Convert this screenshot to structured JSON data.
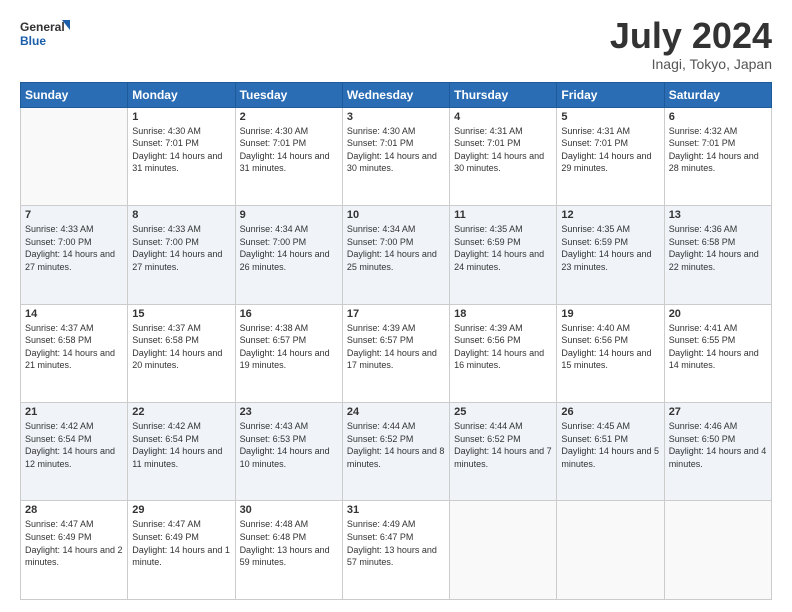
{
  "logo": {
    "line1": "General",
    "line2": "Blue"
  },
  "title": "July 2024",
  "subtitle": "Inagi, Tokyo, Japan",
  "headers": [
    "Sunday",
    "Monday",
    "Tuesday",
    "Wednesday",
    "Thursday",
    "Friday",
    "Saturday"
  ],
  "weeks": [
    [
      {
        "day": "",
        "sunrise": "",
        "sunset": "",
        "daylight": ""
      },
      {
        "day": "1",
        "sunrise": "Sunrise: 4:30 AM",
        "sunset": "Sunset: 7:01 PM",
        "daylight": "Daylight: 14 hours and 31 minutes."
      },
      {
        "day": "2",
        "sunrise": "Sunrise: 4:30 AM",
        "sunset": "Sunset: 7:01 PM",
        "daylight": "Daylight: 14 hours and 31 minutes."
      },
      {
        "day": "3",
        "sunrise": "Sunrise: 4:30 AM",
        "sunset": "Sunset: 7:01 PM",
        "daylight": "Daylight: 14 hours and 30 minutes."
      },
      {
        "day": "4",
        "sunrise": "Sunrise: 4:31 AM",
        "sunset": "Sunset: 7:01 PM",
        "daylight": "Daylight: 14 hours and 30 minutes."
      },
      {
        "day": "5",
        "sunrise": "Sunrise: 4:31 AM",
        "sunset": "Sunset: 7:01 PM",
        "daylight": "Daylight: 14 hours and 29 minutes."
      },
      {
        "day": "6",
        "sunrise": "Sunrise: 4:32 AM",
        "sunset": "Sunset: 7:01 PM",
        "daylight": "Daylight: 14 hours and 28 minutes."
      }
    ],
    [
      {
        "day": "7",
        "sunrise": "Sunrise: 4:33 AM",
        "sunset": "Sunset: 7:00 PM",
        "daylight": "Daylight: 14 hours and 27 minutes."
      },
      {
        "day": "8",
        "sunrise": "Sunrise: 4:33 AM",
        "sunset": "Sunset: 7:00 PM",
        "daylight": "Daylight: 14 hours and 27 minutes."
      },
      {
        "day": "9",
        "sunrise": "Sunrise: 4:34 AM",
        "sunset": "Sunset: 7:00 PM",
        "daylight": "Daylight: 14 hours and 26 minutes."
      },
      {
        "day": "10",
        "sunrise": "Sunrise: 4:34 AM",
        "sunset": "Sunset: 7:00 PM",
        "daylight": "Daylight: 14 hours and 25 minutes."
      },
      {
        "day": "11",
        "sunrise": "Sunrise: 4:35 AM",
        "sunset": "Sunset: 6:59 PM",
        "daylight": "Daylight: 14 hours and 24 minutes."
      },
      {
        "day": "12",
        "sunrise": "Sunrise: 4:35 AM",
        "sunset": "Sunset: 6:59 PM",
        "daylight": "Daylight: 14 hours and 23 minutes."
      },
      {
        "day": "13",
        "sunrise": "Sunrise: 4:36 AM",
        "sunset": "Sunset: 6:58 PM",
        "daylight": "Daylight: 14 hours and 22 minutes."
      }
    ],
    [
      {
        "day": "14",
        "sunrise": "Sunrise: 4:37 AM",
        "sunset": "Sunset: 6:58 PM",
        "daylight": "Daylight: 14 hours and 21 minutes."
      },
      {
        "day": "15",
        "sunrise": "Sunrise: 4:37 AM",
        "sunset": "Sunset: 6:58 PM",
        "daylight": "Daylight: 14 hours and 20 minutes."
      },
      {
        "day": "16",
        "sunrise": "Sunrise: 4:38 AM",
        "sunset": "Sunset: 6:57 PM",
        "daylight": "Daylight: 14 hours and 19 minutes."
      },
      {
        "day": "17",
        "sunrise": "Sunrise: 4:39 AM",
        "sunset": "Sunset: 6:57 PM",
        "daylight": "Daylight: 14 hours and 17 minutes."
      },
      {
        "day": "18",
        "sunrise": "Sunrise: 4:39 AM",
        "sunset": "Sunset: 6:56 PM",
        "daylight": "Daylight: 14 hours and 16 minutes."
      },
      {
        "day": "19",
        "sunrise": "Sunrise: 4:40 AM",
        "sunset": "Sunset: 6:56 PM",
        "daylight": "Daylight: 14 hours and 15 minutes."
      },
      {
        "day": "20",
        "sunrise": "Sunrise: 4:41 AM",
        "sunset": "Sunset: 6:55 PM",
        "daylight": "Daylight: 14 hours and 14 minutes."
      }
    ],
    [
      {
        "day": "21",
        "sunrise": "Sunrise: 4:42 AM",
        "sunset": "Sunset: 6:54 PM",
        "daylight": "Daylight: 14 hours and 12 minutes."
      },
      {
        "day": "22",
        "sunrise": "Sunrise: 4:42 AM",
        "sunset": "Sunset: 6:54 PM",
        "daylight": "Daylight: 14 hours and 11 minutes."
      },
      {
        "day": "23",
        "sunrise": "Sunrise: 4:43 AM",
        "sunset": "Sunset: 6:53 PM",
        "daylight": "Daylight: 14 hours and 10 minutes."
      },
      {
        "day": "24",
        "sunrise": "Sunrise: 4:44 AM",
        "sunset": "Sunset: 6:52 PM",
        "daylight": "Daylight: 14 hours and 8 minutes."
      },
      {
        "day": "25",
        "sunrise": "Sunrise: 4:44 AM",
        "sunset": "Sunset: 6:52 PM",
        "daylight": "Daylight: 14 hours and 7 minutes."
      },
      {
        "day": "26",
        "sunrise": "Sunrise: 4:45 AM",
        "sunset": "Sunset: 6:51 PM",
        "daylight": "Daylight: 14 hours and 5 minutes."
      },
      {
        "day": "27",
        "sunrise": "Sunrise: 4:46 AM",
        "sunset": "Sunset: 6:50 PM",
        "daylight": "Daylight: 14 hours and 4 minutes."
      }
    ],
    [
      {
        "day": "28",
        "sunrise": "Sunrise: 4:47 AM",
        "sunset": "Sunset: 6:49 PM",
        "daylight": "Daylight: 14 hours and 2 minutes."
      },
      {
        "day": "29",
        "sunrise": "Sunrise: 4:47 AM",
        "sunset": "Sunset: 6:49 PM",
        "daylight": "Daylight: 14 hours and 1 minute."
      },
      {
        "day": "30",
        "sunrise": "Sunrise: 4:48 AM",
        "sunset": "Sunset: 6:48 PM",
        "daylight": "Daylight: 13 hours and 59 minutes."
      },
      {
        "day": "31",
        "sunrise": "Sunrise: 4:49 AM",
        "sunset": "Sunset: 6:47 PM",
        "daylight": "Daylight: 13 hours and 57 minutes."
      },
      {
        "day": "",
        "sunrise": "",
        "sunset": "",
        "daylight": ""
      },
      {
        "day": "",
        "sunrise": "",
        "sunset": "",
        "daylight": ""
      },
      {
        "day": "",
        "sunrise": "",
        "sunset": "",
        "daylight": ""
      }
    ]
  ]
}
